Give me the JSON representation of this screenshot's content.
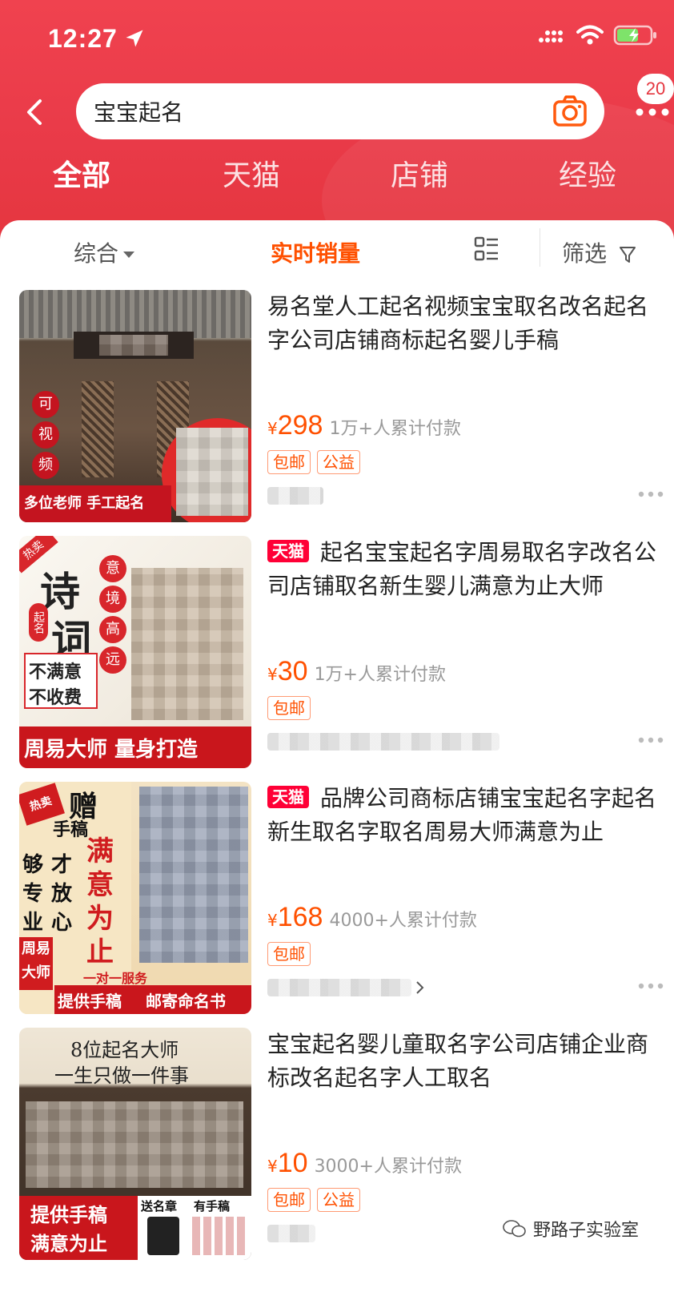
{
  "status_bar": {
    "time": "12:27"
  },
  "search": {
    "query": "宝宝起名",
    "badge_count": "20"
  },
  "tabs": [
    {
      "label": "全部"
    },
    {
      "label": "天猫"
    },
    {
      "label": "店铺"
    },
    {
      "label": "经验"
    }
  ],
  "sort_bar": {
    "comprehensive": "综合",
    "realtime_sales": "实时销量",
    "filter": "筛选"
  },
  "products": [
    {
      "title": "易名堂人工起名视频宝宝取名改名起名字公司店铺商标起名婴儿手稿",
      "tmall": false,
      "price_symbol": "¥",
      "price": "298",
      "sales": "1万+人累计付款",
      "tags": [
        "包邮",
        "公益"
      ],
      "thumb_text": {
        "badge_chars": [
          "可",
          "视",
          "频"
        ],
        "caption": "多位老师 手工起名"
      }
    },
    {
      "title": "起名宝宝起名字周易取名字改名公司店铺取名新生婴儿满意为止大师",
      "tmall": true,
      "tmall_label": "天猫",
      "price_symbol": "¥",
      "price": "30",
      "sales": "1万+人累计付款",
      "tags": [
        "包邮"
      ],
      "thumb_text": {
        "corner": "热卖",
        "big_1": "诗",
        "big_2": "词",
        "small": "起名",
        "vertical": [
          "意",
          "境",
          "高",
          "远"
        ],
        "promise_1": "不满意",
        "promise_2": "不收费",
        "caption": "周易大师  量身打造"
      }
    },
    {
      "title": "品牌公司商标店铺宝宝起名字起名新生取名字取名周易大师满意为止",
      "tmall": true,
      "tmall_label": "天猫",
      "price_symbol": "¥",
      "price": "168",
      "sales": "4000+人累计付款",
      "tags": [
        "包邮"
      ],
      "thumb_text": {
        "corner": "热卖",
        "gift": "赠",
        "gift_sub": "手稿",
        "col_1": [
          "够",
          "专",
          "业"
        ],
        "col_2": [
          "才",
          "放",
          "心"
        ],
        "red_vertical": [
          "满",
          "意",
          "为",
          "止"
        ],
        "master": [
          "周易",
          "大师"
        ],
        "service": "一对一服务",
        "caption_left": "提供手稿",
        "caption_right": "邮寄命名书"
      }
    },
    {
      "title": "宝宝起名婴儿童取名字公司店铺企业商标改名起名字人工取名",
      "tmall": false,
      "price_symbol": "¥",
      "price": "10",
      "sales": "3000+人累计付款",
      "tags": [
        "包邮",
        "公益"
      ],
      "thumb_text": {
        "line_1": "8位起名大师",
        "line_2": "一生只做一件事",
        "bottom_1": "提供手稿",
        "bottom_2": "满意为止",
        "gift_1": "送名章",
        "gift_2": "有手稿"
      }
    }
  ],
  "watermark": "野路子实验室",
  "colors": {
    "header_red": "#e93a48",
    "price_orange": "#ff5000",
    "tmall_red": "#ff0036"
  }
}
